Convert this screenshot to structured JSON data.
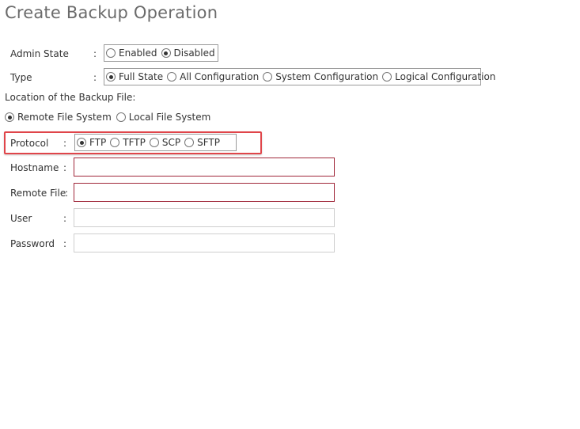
{
  "title": "Create Backup Operation",
  "admin_state": {
    "label": "Admin State",
    "colon": ":",
    "options": [
      "Enabled",
      "Disabled"
    ],
    "selected": "Disabled"
  },
  "type": {
    "label": "Type",
    "colon": ":",
    "options": [
      "Full State",
      "All Configuration",
      "System Configuration",
      "Logical Configuration"
    ],
    "selected": "Full State"
  },
  "location": {
    "label": "Location of the Backup File:",
    "options": [
      "Remote File System",
      "Local File System"
    ],
    "selected": "Remote File System"
  },
  "protocol": {
    "label": "Protocol",
    "colon": ":",
    "options": [
      "FTP",
      "TFTP",
      "SCP",
      "SFTP"
    ],
    "selected": "FTP"
  },
  "fields": {
    "hostname": {
      "label": "Hostname",
      "colon": ":",
      "value": ""
    },
    "remote_file": {
      "label": "Remote File",
      "colon": ":",
      "value": ""
    },
    "user": {
      "label": "User",
      "colon": ":",
      "value": ""
    },
    "password": {
      "label": "Password",
      "colon": ":",
      "value": ""
    }
  },
  "colors": {
    "highlight": "#e0454a",
    "invalid_border": "#a0283a"
  }
}
